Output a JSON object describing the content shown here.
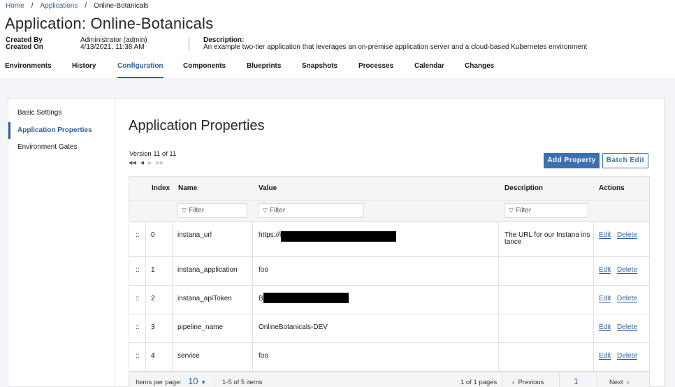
{
  "breadcrumb": {
    "home": "Home",
    "applications": "Applications",
    "current": "Online-Botanicals",
    "separator": "/"
  },
  "page_title": "Application: Online-Botanicals",
  "meta": {
    "created_by_label": "Created By",
    "created_on_label": "Created On",
    "created_by_value": "Administrator (admin)",
    "created_on_value": "4/13/2021, 11:38 AM",
    "description_label": "Description:",
    "description_value": "An example two-tier application that leverages an on-premise application server and a cloud-based Kubernetes environment"
  },
  "tabs": [
    {
      "label": "Environments"
    },
    {
      "label": "History"
    },
    {
      "label": "Configuration",
      "active": true
    },
    {
      "label": "Components"
    },
    {
      "label": "Blueprints"
    },
    {
      "label": "Snapshots"
    },
    {
      "label": "Processes"
    },
    {
      "label": "Calendar"
    },
    {
      "label": "Changes"
    }
  ],
  "sidebar": {
    "items": [
      {
        "label": "Basic Settings"
      },
      {
        "label": "Application Properties",
        "active": true
      },
      {
        "label": "Environment Gates"
      }
    ]
  },
  "panel": {
    "title": "Application Properties",
    "version": "Version 11 of 11",
    "add_property": "Add Property",
    "batch_edit": "Batch Edit"
  },
  "table": {
    "headers": {
      "index": "Index",
      "name": "Name",
      "value": "Value",
      "description": "Description",
      "actions": "Actions"
    },
    "filter_placeholder": "Filter",
    "drag_handle": "::",
    "edit_label": "Edit",
    "delete_label": "Delete",
    "rows": [
      {
        "index": "0",
        "name": "instana_url",
        "value": "https://i",
        "description_line1": "The URL for our Instana ins",
        "description_line2": "tance"
      },
      {
        "index": "1",
        "name": "instana_application",
        "value": "foo",
        "description_line1": "",
        "description_line2": ""
      },
      {
        "index": "2",
        "name": "instana_apiToken",
        "value": "B",
        "description_line1": "",
        "description_line2": ""
      },
      {
        "index": "3",
        "name": "pipeline_name",
        "value": "OnlineBotanicals-DEV",
        "description_line1": "",
        "description_line2": ""
      },
      {
        "index": "4",
        "name": "service",
        "value": "foo",
        "description_line1": "",
        "description_line2": ""
      }
    ]
  },
  "pagination": {
    "items_per_page_label": "Items per page:",
    "items_per_page_value": "10",
    "range": "1-5 of 5 items",
    "pages": "1 of 1 pages",
    "previous": "Previous",
    "current_page": "1",
    "next": "Next"
  },
  "colors": {
    "link": "#2f5f9a",
    "primary": "#3d70b2",
    "background": "#f2f4f8"
  }
}
